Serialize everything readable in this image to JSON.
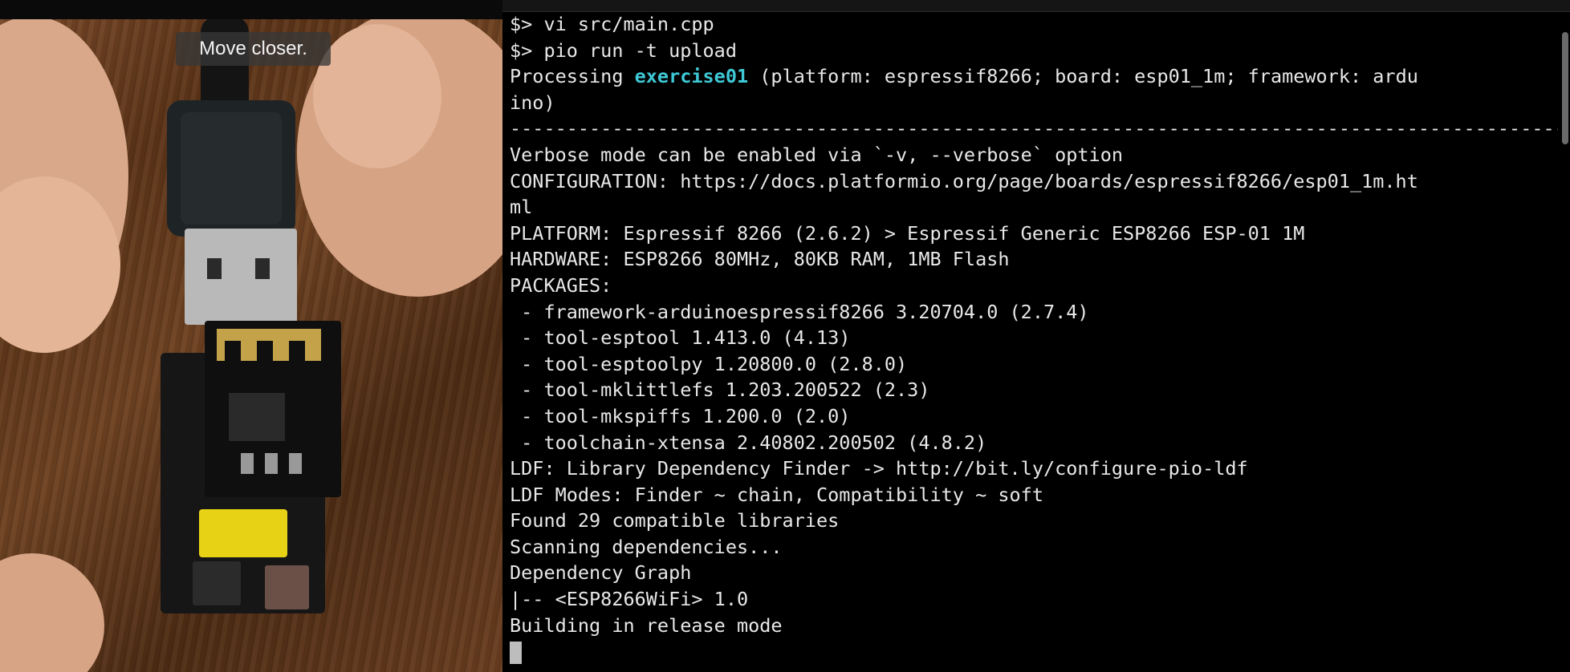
{
  "camera": {
    "overlay_text": "Move closer."
  },
  "terminal": {
    "lines": [
      "$> vi src/main.cpp",
      "$> pio run -t upload",
      "",
      "ino)",
      "------------------------------------------------------------------------------------------------------",
      "Verbose mode can be enabled via `-v, --verbose` option",
      "CONFIGURATION: https://docs.platformio.org/page/boards/espressif8266/esp01_1m.ht",
      "ml",
      "PLATFORM: Espressif 8266 (2.6.2) > Espressif Generic ESP8266 ESP-01 1M",
      "HARDWARE: ESP8266 80MHz, 80KB RAM, 1MB Flash",
      "PACKAGES:",
      " - framework-arduinoespressif8266 3.20704.0 (2.7.4)",
      " - tool-esptool 1.413.0 (4.13)",
      " - tool-esptoolpy 1.20800.0 (2.8.0)",
      " - tool-mklittlefs 1.203.200522 (2.3)",
      " - tool-mkspiffs 1.200.0 (2.0)",
      " - toolchain-xtensa 2.40802.200502 (4.8.2)",
      "LDF: Library Dependency Finder -> http://bit.ly/configure-pio-ldf",
      "LDF Modes: Finder ~ chain, Compatibility ~ soft",
      "Found 29 compatible libraries",
      "Scanning dependencies...",
      "Dependency Graph",
      "|-- <ESP8266WiFi> 1.0",
      "Building in release mode"
    ],
    "processing": {
      "prefix": "Processing ",
      "project": "exercise01",
      "suffix": " (platform: espressif8266; board: esp01_1m; framework: ardu"
    },
    "highlight_color": "#3fc8d6"
  }
}
